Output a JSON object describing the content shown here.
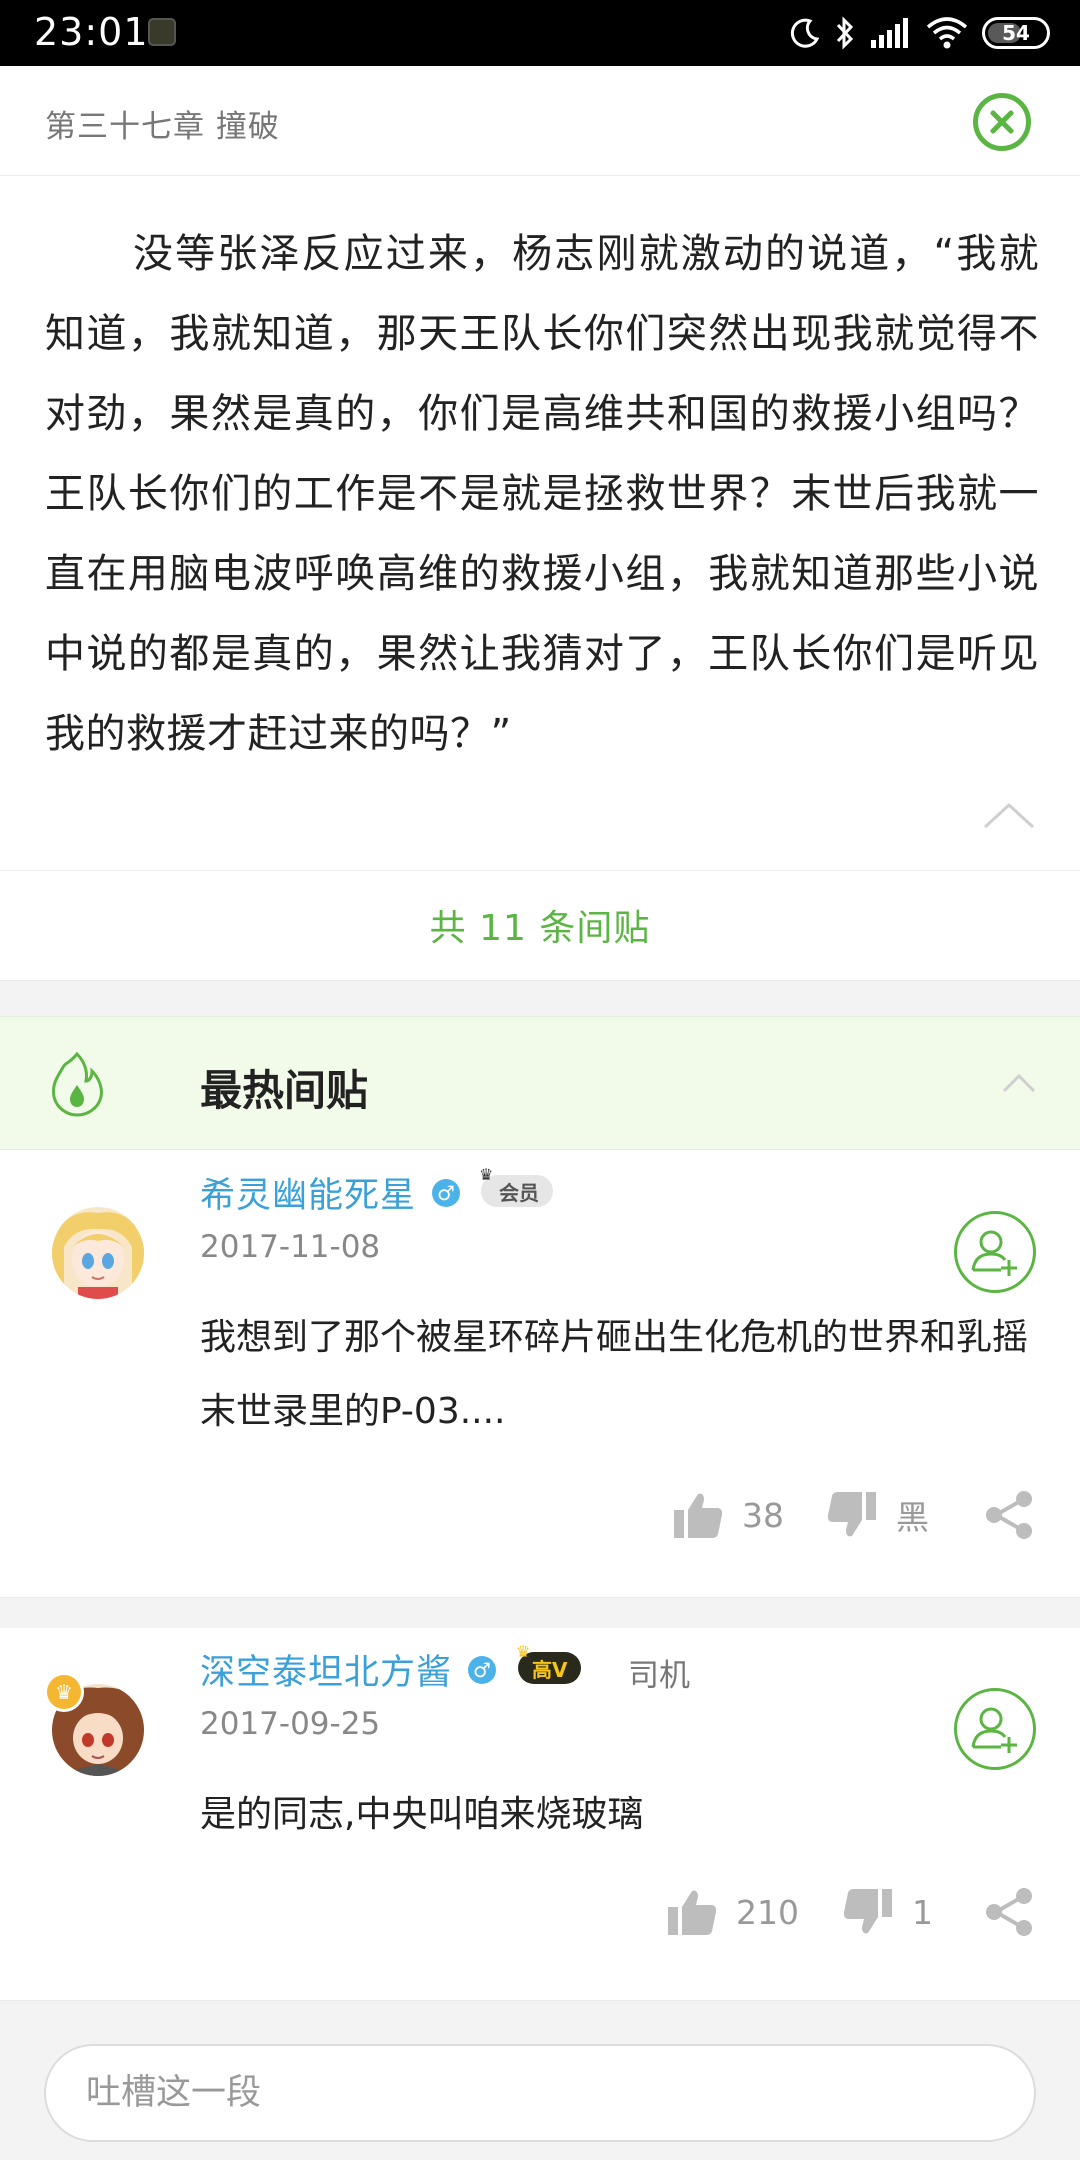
{
  "status_bar": {
    "time": "23:01",
    "battery": "54"
  },
  "header": {
    "chapter_title": "第三十七章  撞破"
  },
  "paragraph": {
    "text": "没等张泽反应过来，杨志刚就激动的说道，“我就知道，我就知道，那天王队长你们突然出现我就觉得不对劲，果然是真的，你们是高维共和国的救援小组吗？王队长你们的工作是不是就是拯救世界？末世后我就一直在用脑电波呼唤高维的救援小组，我就知道那些小说中说的都是真的，果然让我猜对了，王队长你们是听见我的救援才赶过来的吗？”"
  },
  "total_count": "共 11 条间贴",
  "hot_section": {
    "title": "最热间贴"
  },
  "comments": [
    {
      "username": "希灵幽能死星",
      "gender": "♂",
      "badge": "会员",
      "date": "2017-11-08",
      "text": "我想到了那个被星环碎片砸出生化危机的世界和乳摇末世录里的P-03....",
      "likes": "38",
      "dislikes": "黑"
    },
    {
      "username": "深空泰坦北方酱",
      "gender": "♂",
      "badge": "高V",
      "title": "司机",
      "date": "2017-09-25",
      "text": "是的同志,中央叫咱来烧玻璃",
      "likes": "210",
      "dislikes": "1"
    }
  ],
  "input": {
    "placeholder": "吐槽这一段"
  },
  "colors": {
    "accent": "#5bb543",
    "username": "#3aa0d8",
    "hot_bg": "#f2fbea"
  },
  "icons": [
    "moon-icon",
    "bluetooth-icon",
    "signal-icon",
    "wifi-icon",
    "battery-icon",
    "close-icon",
    "chevron-up-icon",
    "flame-icon",
    "gender-male-icon",
    "add-friend-icon",
    "thumbs-up-icon",
    "thumbs-down-icon",
    "share-icon"
  ]
}
